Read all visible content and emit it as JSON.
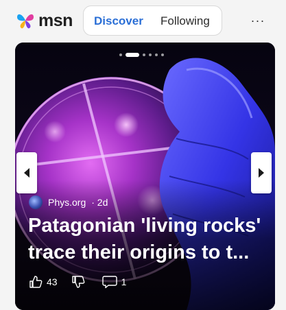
{
  "app": {
    "name": "msn"
  },
  "header": {
    "tabs": [
      {
        "label": "Discover",
        "active": true
      },
      {
        "label": "Following",
        "active": false
      }
    ],
    "more_label": "···"
  },
  "card": {
    "source": {
      "name": "Phys.org",
      "age": "· 2d"
    },
    "headline": "Patagonian 'living rocks' trace their origins to t...",
    "carousel": {
      "count": 6,
      "active_index": 1
    },
    "reactions": {
      "likes": "43",
      "comments": "1"
    }
  },
  "colors": {
    "accent": "#2b6fd6",
    "glove": "#3d3df0",
    "dish_glow": "#c13fe0"
  }
}
